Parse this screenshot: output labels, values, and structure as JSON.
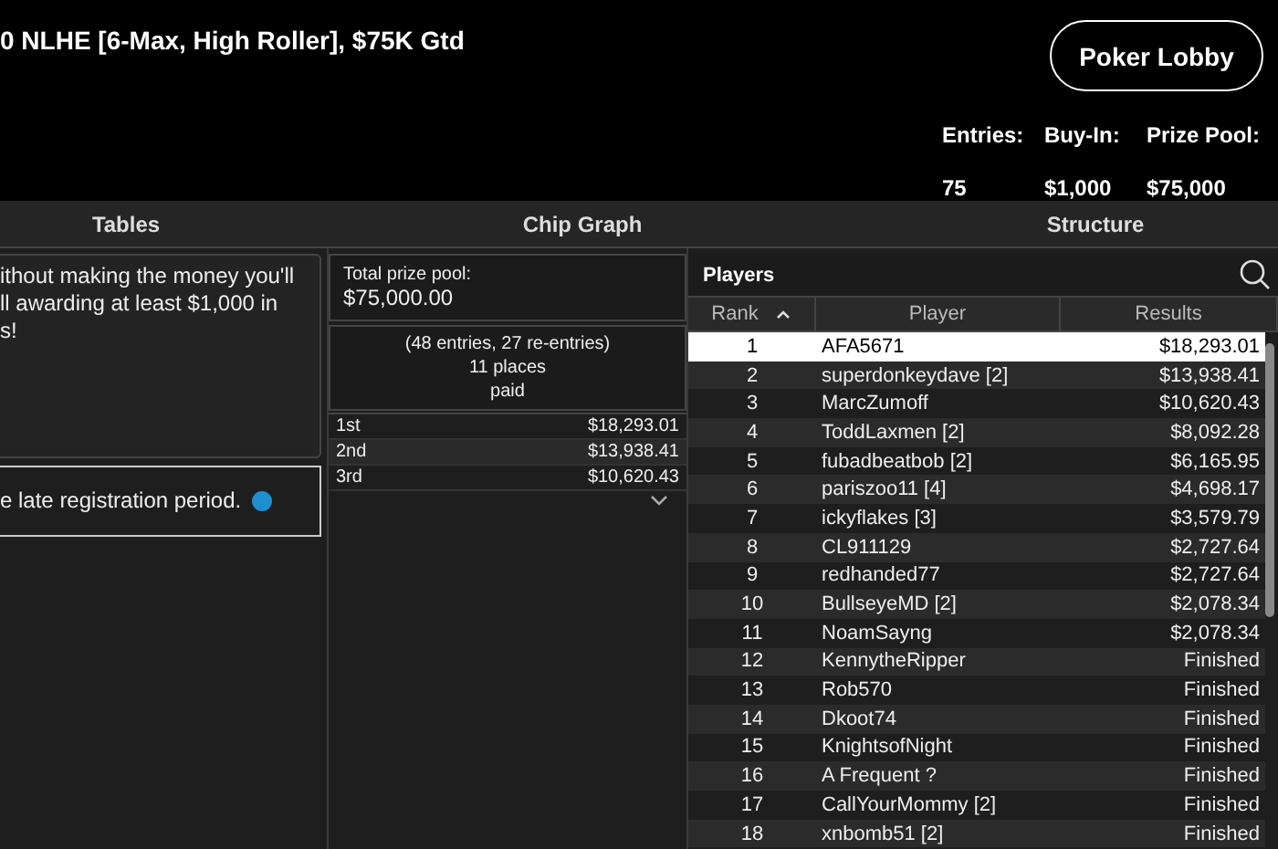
{
  "header": {
    "title": "0 NLHE [6-Max, High Roller], $75K Gtd",
    "lobby_button": "Poker Lobby",
    "stats": [
      {
        "label": "Entries:",
        "value": "75"
      },
      {
        "label": "Buy-In:",
        "value": "$1,000"
      },
      {
        "label": "Prize Pool:",
        "value": "$75,000"
      }
    ]
  },
  "tabs": [
    "Tables",
    "Chip Graph",
    "Structure"
  ],
  "info": {
    "lines": [
      "ithout making the money you'll",
      "ll awarding at least $1,000 in",
      "s!"
    ],
    "late_reg": "e late registration period."
  },
  "prize": {
    "label": "Total prize pool:",
    "amount": "$75,000.00",
    "summary": [
      "(48 entries, 27 re-entries)",
      "11 places",
      "paid"
    ],
    "payouts": [
      {
        "place": "1st",
        "amount": "$18,293.01"
      },
      {
        "place": "2nd",
        "amount": "$13,938.41"
      },
      {
        "place": "3rd",
        "amount": "$10,620.43"
      }
    ]
  },
  "players": {
    "title": "Players",
    "columns": [
      "Rank",
      "Player",
      "Results"
    ],
    "rows": [
      {
        "rank": "1",
        "player": "AFA5671",
        "result": "$18,293.01",
        "selected": true
      },
      {
        "rank": "2",
        "player": "superdonkeydave [2]",
        "result": "$13,938.41",
        "selected": false
      },
      {
        "rank": "3",
        "player": "MarcZumoff",
        "result": "$10,620.43",
        "selected": false
      },
      {
        "rank": "4",
        "player": "ToddLaxmen [2]",
        "result": "$8,092.28",
        "selected": false
      },
      {
        "rank": "5",
        "player": "fubadbeatbob [2]",
        "result": "$6,165.95",
        "selected": false
      },
      {
        "rank": "6",
        "player": "pariszoo11 [4]",
        "result": "$4,698.17",
        "selected": false
      },
      {
        "rank": "7",
        "player": "ickyflakes [3]",
        "result": "$3,579.79",
        "selected": false
      },
      {
        "rank": "8",
        "player": "CL911129",
        "result": "$2,727.64",
        "selected": false
      },
      {
        "rank": "9",
        "player": "redhanded77",
        "result": "$2,727.64",
        "selected": false
      },
      {
        "rank": "10",
        "player": "BullseyeMD [2]",
        "result": "$2,078.34",
        "selected": false
      },
      {
        "rank": "11",
        "player": "NoamSayng",
        "result": "$2,078.34",
        "selected": false
      },
      {
        "rank": "12",
        "player": "KennytheRipper",
        "result": "Finished",
        "selected": false
      },
      {
        "rank": "13",
        "player": "Rob570",
        "result": "Finished",
        "selected": false
      },
      {
        "rank": "14",
        "player": "Dkoot74",
        "result": "Finished",
        "selected": false
      },
      {
        "rank": "15",
        "player": "KnightsofNight",
        "result": "Finished",
        "selected": false
      },
      {
        "rank": "16",
        "player": "A Frequent ?",
        "result": "Finished",
        "selected": false
      },
      {
        "rank": "17",
        "player": "CallYourMommy [2]",
        "result": "Finished",
        "selected": false
      },
      {
        "rank": "18",
        "player": "xnbomb51 [2]",
        "result": "Finished",
        "selected": false
      }
    ]
  }
}
